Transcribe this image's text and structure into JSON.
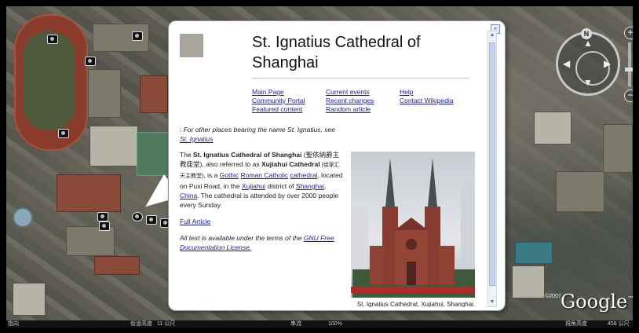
{
  "balloon": {
    "title": "St. Ignatius Cathedral of Shanghai",
    "links_col1": [
      "Main Page",
      "Community Portal",
      "Featured content"
    ],
    "links_col2": [
      "Current events",
      "Recent changes",
      "Random article"
    ],
    "links_col3": [
      "Help",
      "Contact Wikipedia"
    ],
    "note_prefix": ": For other places bearing the name St. Ignatius, see ",
    "note_link": "St. Ignatius",
    "body_the": "The ",
    "body_name": "St. Ignatius Cathedral of Shanghai",
    "body_chinese1": " (聖依納爵主教座堂)",
    "body_aka": ", also referred to as ",
    "body_xujiahui": "Xujiahui Cathedral",
    "body_chinese2": " (徐家汇天主教堂)",
    "body_isa": ", is a ",
    "link_gothic": "Gothic",
    "link_roman": "Roman Catholic",
    "link_cathedral": "cathedral",
    "body_located": ", located on Puxi Road, in the ",
    "link_xujiahui": "Xujiahui",
    "body_district": " district of ",
    "link_shanghai": "Shanghai",
    "link_china": "China",
    "body_end": ". The cathedral is attended by over 2000 people every Sunday.",
    "full_article": "Full Article",
    "license_prefix": "All text is available under the terms of the ",
    "license_link": "GNU Free Documentation License.",
    "caption": "St. Ignatius Cathedral, Xujiahui, Shanghai.",
    "close_glyph": "×"
  },
  "nav": {
    "north": "N",
    "up": "▲",
    "down": "▼",
    "left": "◀",
    "right": "▶",
    "zoom_in": "+",
    "zoom_out": "−"
  },
  "status": {
    "pointer": "指向",
    "street_label": "街道高度",
    "street_value": "11 公尺",
    "stream_label": "串流",
    "stream_value": "100%",
    "eye_label": "視角高度",
    "eye_value": "458 公尺"
  },
  "brand": {
    "logo": "Google",
    "tm": "™",
    "copyright": "©2007"
  }
}
